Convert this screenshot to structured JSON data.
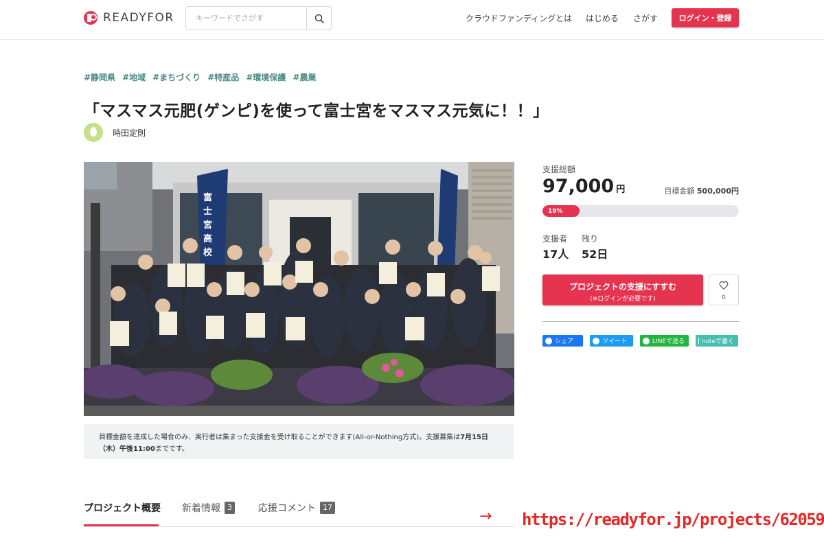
{
  "header": {
    "logo_text": "READYFOR",
    "search_placeholder": "キーワードでさがす",
    "nav": {
      "about": "クラウドファンディングとは",
      "start": "はじめる",
      "find": "さがす"
    },
    "login_label": "ログイン・登録"
  },
  "project": {
    "tags": [
      "#静岡県",
      "#地域",
      "#まちづくり",
      "#特産品",
      "#環境保護",
      "#農業"
    ],
    "title": "「マスマス元肥(ゲンピ)を使って富士宮をマスマス元気に！！」",
    "owner": "時田定則",
    "photo_banner_text": "富士宮高校"
  },
  "notice": {
    "text_before": "目標金額を達成した場合のみ、実行者は集まった支援金を受け取ることができます(All-or-Nothing方式)。支援募集は",
    "date_bold": "7月15日（木）午後11:00",
    "text_after": "までです。"
  },
  "tabs": [
    {
      "label": "プロジェクト概要"
    },
    {
      "label": "新着情報",
      "count": "3"
    },
    {
      "label": "応援コメント",
      "count": "17"
    }
  ],
  "sidebar": {
    "total_label": "支援総額",
    "total_amount": "97,000",
    "total_unit": "円",
    "goal_label": "目標金額",
    "goal_amount": "500,000円",
    "progress_percent": 19,
    "progress_text": "19%",
    "supporters_label": "支援者",
    "supporters_value": "17人",
    "remaining_label": "残り",
    "remaining_value": "52日",
    "support_button_main": "プロジェクトの支援にすすむ",
    "support_button_sub": "(※ログインが必要です)",
    "favorite_count": "0",
    "share": {
      "facebook": "シェア",
      "twitter": "ツイート",
      "line": "LINEで送る",
      "note": "noteで書く"
    }
  },
  "annotation": {
    "arrow": "→",
    "url": "https://readyfor.jp/projects/62059"
  },
  "colors": {
    "brand": "#e6334f",
    "tag": "#4b8a82",
    "annotation": "#e82828"
  }
}
